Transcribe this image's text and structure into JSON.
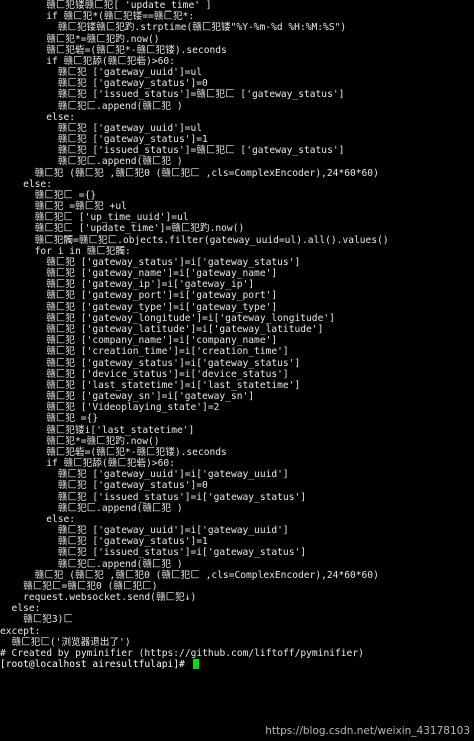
{
  "terminal": {
    "lines": [
      "        赣匚犯镂赣匚犯[ 'update_time' ]",
      "        if 赣匚犯*(赣匚犯镂==赣匚犯*:",
      "          赣匚犯镂赣匚犯趵.strptime(赣匚犯镂\"%Y-%m-%d %H:%M:%S\")",
      "        赣匚犯*=赣匚犯趵.now()",
      "        赣匚犯砦=(赣匚犯*-赣匚犯镂).seconds",
      "        if 赣匚犯舔(赣匚犯砦)>60:",
      "          赣匚犯 ['gateway_uuid']=ul",
      "          赣匚犯 ['gateway_status']=0",
      "          赣匚犯 ['issued_status']=赣匚犯匚 ['gateway_status']",
      "          赣匚犯匚.append(赣匚犯 )",
      "        else:",
      "          赣匚犯 ['gateway_uuid']=ul",
      "          赣匚犯 ['gateway_status']=1",
      "          赣匚犯 ['issued_status']=赣匚犯匚 ['gateway_status']",
      "          赣匚犯匚.append(赣匚犯 )",
      "      赣匚犯 (赣匚犯 ,赣匚犯0 (赣匚犯匚 ,cls=ComplexEncoder),24*60*60)",
      "    else:",
      "      赣匚犯匚 ={}",
      "      赣匚犯 =赣匚犯 +ul",
      "      赣匚犯匚 ['up_time_uuid']=ul",
      "      赣匚犯匚 ['update_time']=赣匚犯趵.now()",
      "      赣匚犯髑=赣匚犯匚.objects.filter(gateway_uuid=ul).all().values()",
      "      for i in 赣匚犯髑:",
      "        赣匚犯 ['gateway_status']=i['gateway_status']",
      "        赣匚犯 ['gateway_name']=i['gateway_name']",
      "        赣匚犯 ['gateway_ip']=i['gateway_ip']",
      "        赣匚犯 ['gateway_port']=i['gateway_port']",
      "        赣匚犯 ['gateway_type']=i['gateway_type']",
      "        赣匚犯 ['gateway_longitude']=i['gateway_longitude']",
      "        赣匚犯 ['gateway_latitude']=i['gateway_latitude']",
      "        赣匚犯 ['company_name']=i['company_name']",
      "        赣匚犯 ['creation_time']=i['creation_time']",
      "        赣匚犯 ['gateway_status']=i['gateway_status']",
      "        赣匚犯 ['device_status']=i['device_status']",
      "        赣匚犯 ['last_statetime']=i['last_statetime']",
      "        赣匚犯 ['gateway_sn']=i['gateway_sn']",
      "        赣匚犯 ['Videoplaying_state']=2",
      "        赣匚犯 ={}",
      "        赣匚犯镂i['last_statetime']",
      "        赣匚犯*=赣匚犯趵.now()",
      "        赣匚犯砦=(赣匚犯*-赣匚犯镂).seconds",
      "        if 赣匚犯舔(赣匚犯砦)>60:",
      "          赣匚犯 ['gateway_uuid']=i['gateway_uuid']",
      "          赣匚犯 ['gateway_status']=0",
      "          赣匚犯 ['issued_status']=i['gateway_status']",
      "          赣匚犯匚.append(赣匚犯 )",
      "        else:",
      "          赣匚犯 ['gateway_uuid']=i['gateway_uuid']",
      "          赣匚犯 ['gateway_status']=1",
      "          赣匚犯 ['issued_status']=i['gateway_status']",
      "          赣匚犯匚.append(赣匚犯 )",
      "      赣匚犯 (赣匚犯 ,赣匚犯0 (赣匚犯匚 ,cls=ComplexEncoder),24*60*60)",
      "    赣匚犯匚=赣匚犯0 (赣匚犯匚)",
      "    request.websocket.send(赣匚犯↓)",
      "  else:",
      "    赣匚犯3)匚",
      "except:",
      "  赣匚犯匚('浏览器退出了')",
      "# Created by pyminifier (https://github.com/liftoff/pyminifier)"
    ],
    "prompt": "[root@localhost airesultfulapi]# ",
    "watermark": "https://blog.csdn.net/weixin_43178103"
  },
  "colors": {
    "background": "#000000",
    "text": "#e8e8e8",
    "cursor": "#00e000"
  }
}
